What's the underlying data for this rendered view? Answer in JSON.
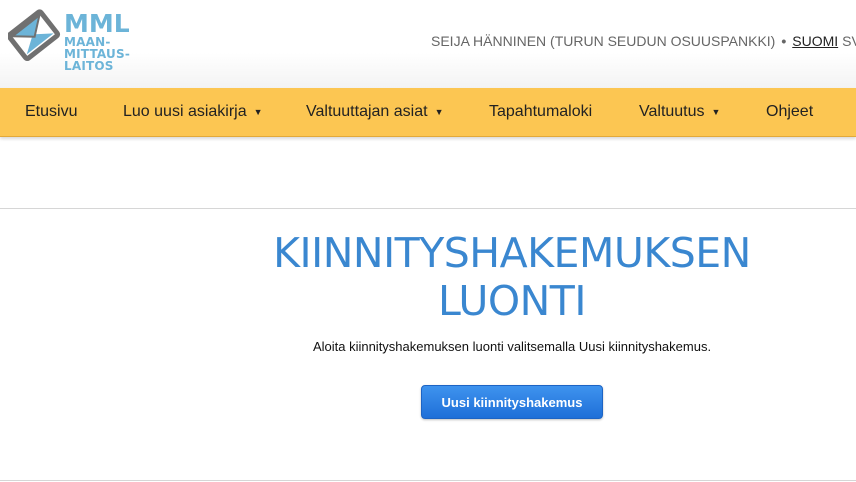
{
  "header": {
    "logo": {
      "main": "MML",
      "line1": "MAAN-",
      "line2": "MITTAUS-",
      "line3": "LAITOS"
    },
    "user": "SEIJA HÄNNINEN (TURUN SEUDUN OSUUSPANKKI)",
    "separator": "•",
    "language_active": "SUOMI",
    "language_other": "SV"
  },
  "nav": {
    "items": [
      {
        "label": "Etusivu",
        "dropdown": false
      },
      {
        "label": "Luo uusi asiakirja",
        "dropdown": true
      },
      {
        "label": "Valtuuttajan asiat",
        "dropdown": true
      },
      {
        "label": "Tapahtumaloki",
        "dropdown": false
      },
      {
        "label": "Valtuutus",
        "dropdown": true
      },
      {
        "label": "Ohjeet",
        "dropdown": false
      }
    ],
    "caret": "▼"
  },
  "main": {
    "title_line1": "KIINNITYSHAKEMUKSEN",
    "title_line2": "LUONTI",
    "instruction": "Aloita kiinnityshakemuksen luonti valitsemalla Uusi kiinnityshakemus.",
    "button_label": "Uusi kiinnityshakemus"
  },
  "colors": {
    "nav_background": "#fcc652",
    "title": "#3a87d0",
    "button": "#2a7de1",
    "logo": "#6cb4d8"
  }
}
